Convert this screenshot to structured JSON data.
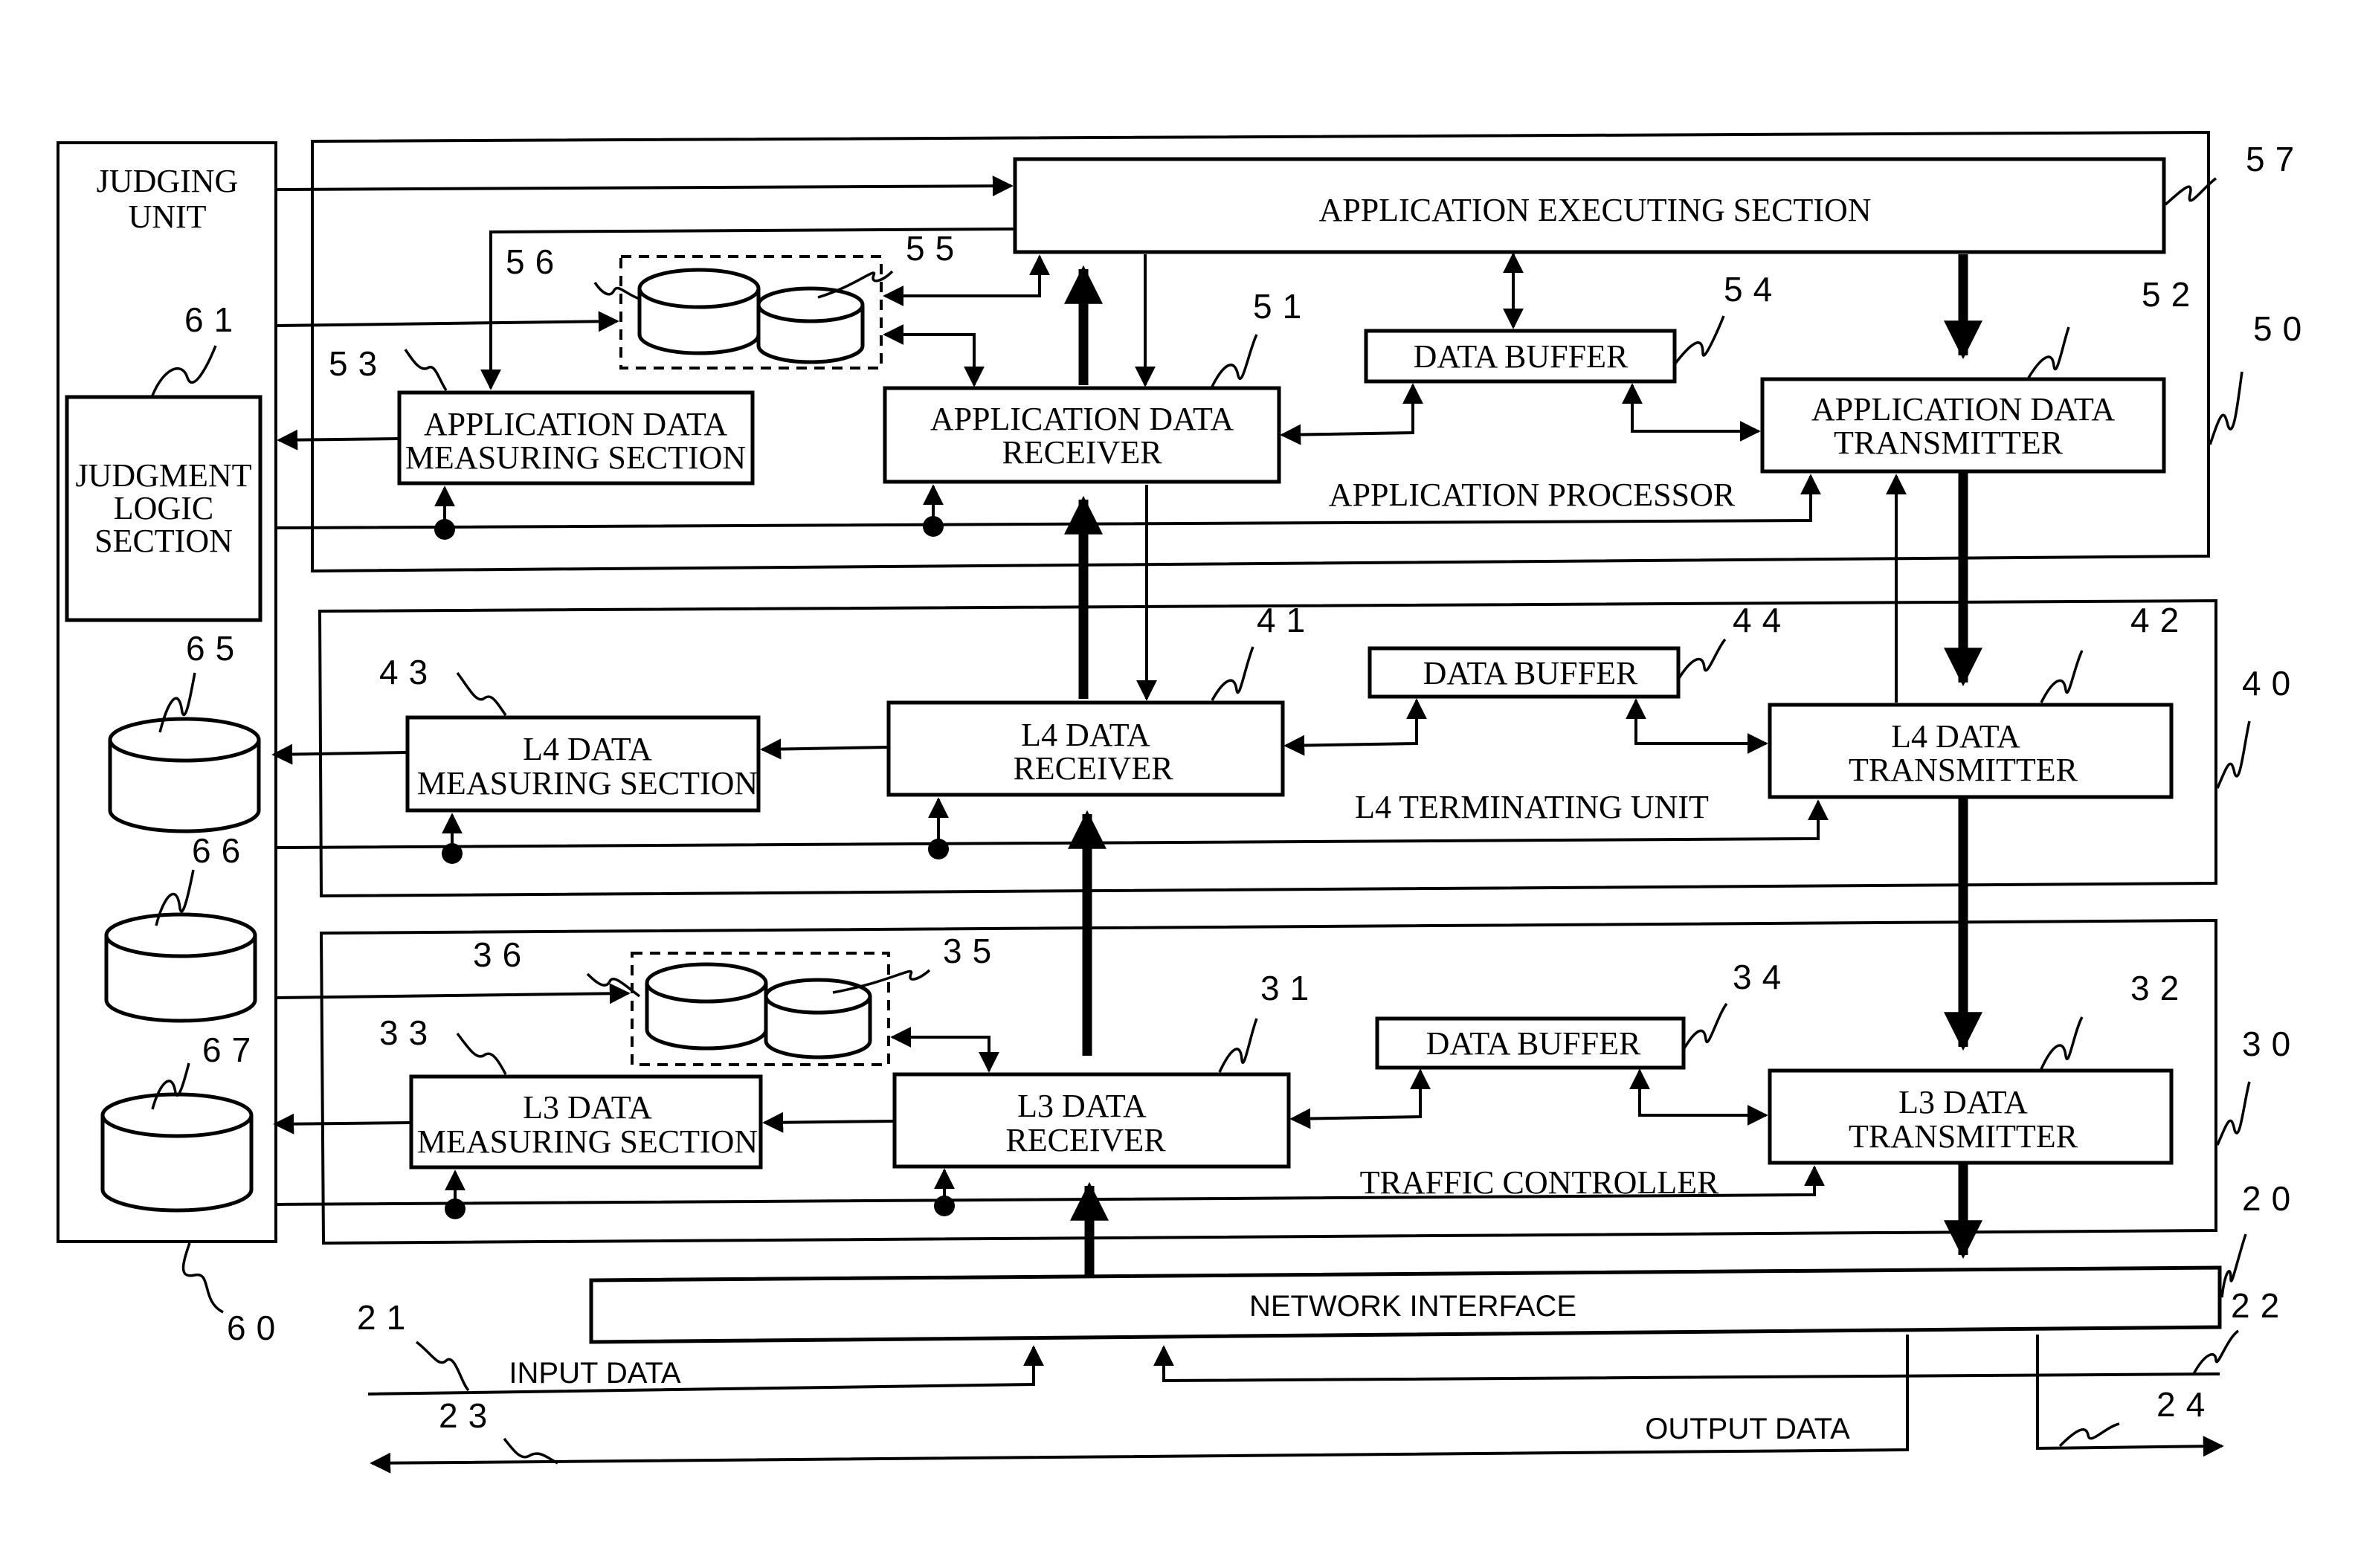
{
  "diagram": {
    "judging_unit": {
      "ref": "60",
      "title_line1": "JUDGING",
      "title_line2": "UNIT",
      "logic": {
        "ref": "61",
        "line1": "JUDGMENT",
        "line2": "LOGIC",
        "line3": "SECTION"
      },
      "stores": [
        {
          "ref": "65"
        },
        {
          "ref": "66"
        },
        {
          "ref": "67"
        }
      ]
    },
    "application_processor": {
      "ref": "50",
      "label": "APPLICATION PROCESSOR",
      "executing": {
        "ref": "57",
        "label": "APPLICATION EXECUTING SECTION"
      },
      "receiver": {
        "ref": "51",
        "line1": "APPLICATION DATA",
        "line2": "RECEIVER"
      },
      "transmitter": {
        "ref": "52",
        "line1": "APPLICATION DATA",
        "line2": "TRANSMITTER"
      },
      "measuring": {
        "ref": "53",
        "line1": "APPLICATION DATA",
        "line2": "MEASURING SECTION"
      },
      "buffer": {
        "ref": "54",
        "label": "DATA BUFFER"
      },
      "store_a": {
        "ref": "55"
      },
      "store_group": {
        "ref": "56"
      }
    },
    "l4_unit": {
      "ref": "40",
      "label": "L4 TERMINATING UNIT",
      "receiver": {
        "ref": "41",
        "line1": "L4 DATA",
        "line2": "RECEIVER"
      },
      "transmitter": {
        "ref": "42",
        "line1": "L4 DATA",
        "line2": "TRANSMITTER"
      },
      "measuring": {
        "ref": "43",
        "line1": "L4 DATA",
        "line2": "MEASURING SECTION"
      },
      "buffer": {
        "ref": "44",
        "label": "DATA BUFFER"
      }
    },
    "traffic_controller": {
      "ref": "30",
      "label": "TRAFFIC CONTROLLER",
      "receiver": {
        "ref": "31",
        "line1": "L3 DATA",
        "line2": "RECEIVER"
      },
      "transmitter": {
        "ref": "32",
        "line1": "L3 DATA",
        "line2": "TRANSMITTER"
      },
      "measuring": {
        "ref": "33",
        "line1": "L3 DATA",
        "line2": "MEASURING SECTION"
      },
      "buffer": {
        "ref": "34",
        "label": "DATA BUFFER"
      },
      "store_a": {
        "ref": "35"
      },
      "store_group": {
        "ref": "36"
      }
    },
    "network_interface": {
      "ref": "20",
      "label": "NETWORK  INTERFACE"
    },
    "io": {
      "input_ref": "21",
      "input_label": "INPUT DATA",
      "input2_ref": "22",
      "output_ref": "23",
      "output_label": "OUTPUT DATA",
      "output2_ref": "24"
    }
  }
}
